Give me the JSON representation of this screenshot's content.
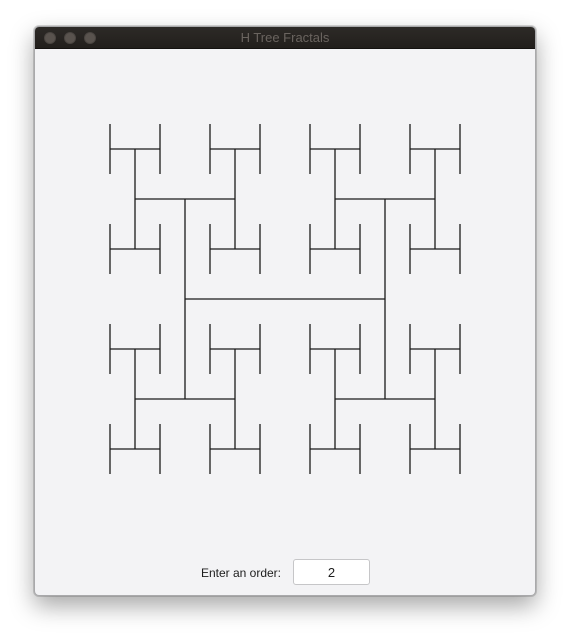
{
  "window": {
    "title": "H Tree Fractals"
  },
  "controls": {
    "order_label": "Enter an order:",
    "order_value": "2"
  },
  "fractal": {
    "type": "H-tree",
    "order": 2,
    "line_color": "#1a1a1a",
    "background": "#f3f3f5"
  }
}
